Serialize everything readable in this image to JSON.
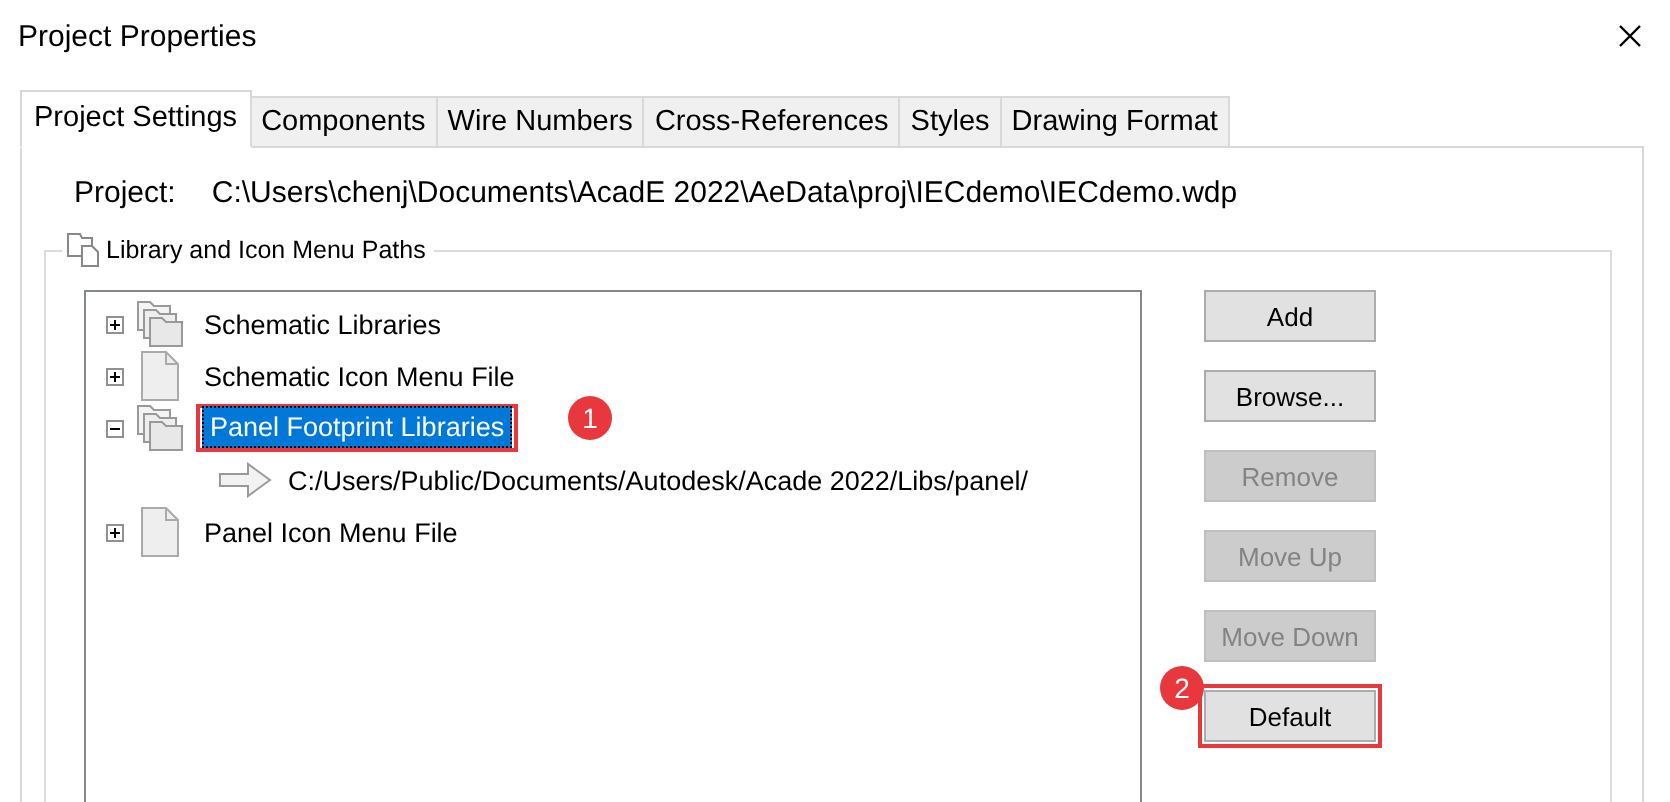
{
  "window": {
    "title": "Project Properties"
  },
  "tabs": [
    {
      "label": "Project Settings",
      "selected": true
    },
    {
      "label": "Components",
      "selected": false
    },
    {
      "label": "Wire Numbers",
      "selected": false
    },
    {
      "label": "Cross-References",
      "selected": false
    },
    {
      "label": "Styles",
      "selected": false
    },
    {
      "label": "Drawing Format",
      "selected": false
    }
  ],
  "project": {
    "label": "Project:",
    "path": "C:\\Users\\chenj\\Documents\\AcadE 2022\\AeData\\proj\\IECdemo\\IECdemo.wdp"
  },
  "group": {
    "title": "Library and Icon Menu Paths"
  },
  "tree": [
    {
      "kind": "folder",
      "label": "Schematic Libraries",
      "expanded": false,
      "selected": false
    },
    {
      "kind": "file",
      "label": "Schematic Icon Menu File",
      "expanded": false,
      "selected": false
    },
    {
      "kind": "folder",
      "label": "Panel Footprint Libraries",
      "expanded": true,
      "selected": true,
      "callout": "1",
      "children": [
        {
          "kind": "path",
          "label": "C:/Users/Public/Documents/Autodesk/Acade 2022/Libs/panel/",
          "selected": false
        }
      ]
    },
    {
      "kind": "file",
      "label": "Panel Icon Menu File",
      "expanded": false,
      "selected": false
    }
  ],
  "buttons": [
    {
      "label": "Add",
      "disabled": false
    },
    {
      "label": "Browse...",
      "disabled": false
    },
    {
      "label": "Remove",
      "disabled": true
    },
    {
      "label": "Move Up",
      "disabled": true
    },
    {
      "label": "Move Down",
      "disabled": true
    },
    {
      "label": "Default",
      "disabled": false,
      "callout": "2"
    }
  ]
}
